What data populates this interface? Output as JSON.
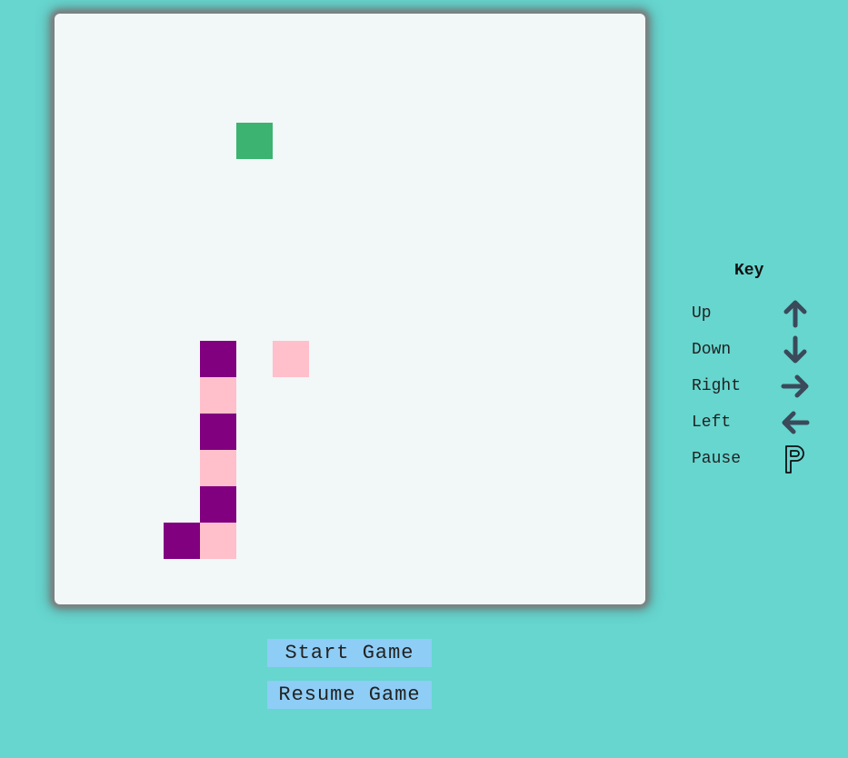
{
  "colors": {
    "background": "#66d6cf",
    "board": "#f2f7f7",
    "food": "#3cb371",
    "snake_dark": "#800080",
    "snake_light": "#ffc0cb",
    "button": "#8ecdf6",
    "key_icon": "#3a4a5a"
  },
  "game": {
    "grid_cols": 16,
    "grid_rows": 16,
    "food": {
      "col": 5,
      "row": 3
    },
    "snake": [
      {
        "col": 6,
        "row": 9,
        "color": "snake_light"
      },
      {
        "col": 4,
        "row": 9,
        "color": "snake_dark"
      },
      {
        "col": 4,
        "row": 10,
        "color": "snake_light"
      },
      {
        "col": 4,
        "row": 11,
        "color": "snake_dark"
      },
      {
        "col": 4,
        "row": 12,
        "color": "snake_light"
      },
      {
        "col": 4,
        "row": 13,
        "color": "snake_dark"
      },
      {
        "col": 4,
        "row": 14,
        "color": "snake_light"
      },
      {
        "col": 3,
        "row": 14,
        "color": "snake_dark"
      }
    ]
  },
  "buttons": {
    "start": "Start Game",
    "resume": "Resume Game"
  },
  "key": {
    "title": "Key",
    "items": [
      {
        "label": "Up",
        "icon": "arrow-up-icon"
      },
      {
        "label": "Down",
        "icon": "arrow-down-icon"
      },
      {
        "label": "Right",
        "icon": "arrow-right-icon"
      },
      {
        "label": "Left",
        "icon": "arrow-left-icon"
      },
      {
        "label": "Pause",
        "icon": "letter-p-icon"
      }
    ]
  }
}
